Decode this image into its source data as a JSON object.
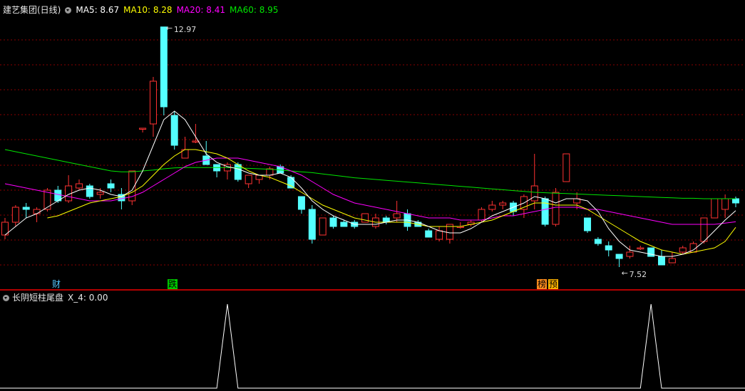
{
  "header": {
    "title": "建艺集团(日线)",
    "ma5": "MA5: 8.67",
    "ma10": "MA10: 8.28",
    "ma20": "MA20: 8.41",
    "ma60": "MA60: 8.95"
  },
  "sub_header": {
    "title": "长阴短柱尾盘",
    "value": "X_4: 0.00"
  },
  "tags": {
    "t1": "财",
    "t2": "跌",
    "t3": "榜",
    "t4": "预"
  },
  "annotations": {
    "high": "12.97",
    "low": "7.52"
  },
  "colors": {
    "up": "#ff3232",
    "down": "#54ffff",
    "ma5": "#ffffff",
    "ma10": "#ffff00",
    "ma20": "#ff00ff",
    "ma60": "#00e600",
    "grid": "#8a0000",
    "sep": "#b40000"
  },
  "chart_data": [
    {
      "type": "candlestick",
      "ylim": [
        7.1,
        13.2
      ],
      "grid": true,
      "candles": [
        [
          8.1,
          8.4,
          8.5,
          8.0
        ],
        [
          8.4,
          8.75,
          8.8,
          8.3
        ],
        [
          8.75,
          8.7,
          8.85,
          8.5
        ],
        [
          8.6,
          8.7,
          8.75,
          8.4
        ],
        [
          8.7,
          9.15,
          9.2,
          8.65
        ],
        [
          9.15,
          8.9,
          9.25,
          8.85
        ],
        [
          8.9,
          9.25,
          9.5,
          8.85
        ],
        [
          9.2,
          9.3,
          9.4,
          9.15
        ],
        [
          9.25,
          9.0,
          9.3,
          8.95
        ],
        [
          9.05,
          9.1,
          9.2,
          8.95
        ],
        [
          9.3,
          9.2,
          9.4,
          9.1
        ],
        [
          9.05,
          8.9,
          9.2,
          8.7
        ],
        [
          8.9,
          9.6,
          9.6,
          8.8
        ],
        [
          10.6,
          10.6,
          10.6,
          10.5
        ],
        [
          10.7,
          11.7,
          11.8,
          10.4
        ],
        [
          12.97,
          11.1,
          12.97,
          10.9
        ],
        [
          10.9,
          10.2,
          11.0,
          10.1
        ],
        [
          9.9,
          10.1,
          10.4,
          9.9
        ],
        [
          10.3,
          10.3,
          10.7,
          10.25
        ],
        [
          9.95,
          9.75,
          10.3,
          9.75
        ],
        [
          9.75,
          9.6,
          9.75,
          9.45
        ],
        [
          9.6,
          9.75,
          9.8,
          9.4
        ],
        [
          9.75,
          9.4,
          9.8,
          9.35
        ],
        [
          9.3,
          9.5,
          9.5,
          9.2
        ],
        [
          9.4,
          9.5,
          9.5,
          9.3
        ],
        [
          9.5,
          9.65,
          9.7,
          9.4
        ],
        [
          9.7,
          9.55,
          9.75,
          9.55
        ],
        [
          9.45,
          9.2,
          9.5,
          9.2
        ],
        [
          9.0,
          8.7,
          9.0,
          8.6
        ],
        [
          8.7,
          8.0,
          8.8,
          7.9
        ],
        [
          8.1,
          8.5,
          8.5,
          8.1
        ],
        [
          8.5,
          8.3,
          8.55,
          8.25
        ],
        [
          8.4,
          8.3,
          8.45,
          8.3
        ],
        [
          8.4,
          8.3,
          8.45,
          8.25
        ],
        [
          8.4,
          8.6,
          8.6,
          8.4
        ],
        [
          8.3,
          8.5,
          8.6,
          8.25
        ],
        [
          8.5,
          8.4,
          8.55,
          8.35
        ],
        [
          8.5,
          8.6,
          8.9,
          8.4
        ],
        [
          8.6,
          8.3,
          8.7,
          8.2
        ],
        [
          8.4,
          8.3,
          8.45,
          8.3
        ],
        [
          8.2,
          8.05,
          8.25,
          8.05
        ],
        [
          8.0,
          8.2,
          8.3,
          7.95
        ],
        [
          8.0,
          8.35,
          8.35,
          7.9
        ],
        [
          8.3,
          8.3,
          8.4,
          8.25
        ],
        [
          8.35,
          8.4,
          8.45,
          8.3
        ],
        [
          8.45,
          8.7,
          8.75,
          8.4
        ],
        [
          8.7,
          8.8,
          8.9,
          8.65
        ],
        [
          8.8,
          8.85,
          8.9,
          8.7
        ],
        [
          8.85,
          8.65,
          8.9,
          8.55
        ],
        [
          8.7,
          9.0,
          9.05,
          8.5
        ],
        [
          8.9,
          9.25,
          10.0,
          8.7
        ],
        [
          8.95,
          8.35,
          9.0,
          8.3
        ],
        [
          8.35,
          9.1,
          9.2,
          8.3
        ],
        [
          9.35,
          10.0,
          10.0,
          9.35
        ],
        [
          8.85,
          8.95,
          9.1,
          8.7
        ],
        [
          8.5,
          8.2,
          8.5,
          8.15
        ],
        [
          8.0,
          7.9,
          8.05,
          7.85
        ],
        [
          7.85,
          7.75,
          7.95,
          7.6
        ],
        [
          7.65,
          7.55,
          7.65,
          7.35
        ],
        [
          7.6,
          7.7,
          7.85,
          7.55
        ],
        [
          7.8,
          7.8,
          7.85,
          7.75
        ],
        [
          7.8,
          7.6,
          7.8,
          7.6
        ],
        [
          7.6,
          7.4,
          7.75,
          7.4
        ],
        [
          7.45,
          7.55,
          7.7,
          7.52
        ],
        [
          7.7,
          7.8,
          7.85,
          7.65
        ],
        [
          7.7,
          7.9,
          7.95,
          7.7
        ],
        [
          7.95,
          8.5,
          8.5,
          7.9
        ],
        [
          8.5,
          8.95,
          8.95,
          8.5
        ],
        [
          8.7,
          8.95,
          9.05,
          8.5
        ],
        [
          8.95,
          8.85,
          9.0,
          8.75
        ]
      ],
      "ma5": [
        8.1,
        8.3,
        8.5,
        8.6,
        8.75,
        8.9,
        9.05,
        9.15,
        9.2,
        9.15,
        9.05,
        9.0,
        9.15,
        9.6,
        10.2,
        10.8,
        11.0,
        10.8,
        10.4,
        10.0,
        9.8,
        9.7,
        9.65,
        9.55,
        9.5,
        9.5,
        9.55,
        9.45,
        9.2,
        8.9,
        8.7,
        8.55,
        8.45,
        8.35,
        8.35,
        8.35,
        8.4,
        8.45,
        8.45,
        8.4,
        8.3,
        8.2,
        8.15,
        8.15,
        8.25,
        8.4,
        8.55,
        8.65,
        8.75,
        8.85,
        9.0,
        8.95,
        8.85,
        8.95,
        8.95,
        8.9,
        8.65,
        8.25,
        7.95,
        7.75,
        7.7,
        7.65,
        7.6,
        7.6,
        7.65,
        7.75,
        7.95,
        8.2,
        8.45,
        8.67
      ],
      "ma10": [
        null,
        null,
        null,
        null,
        8.5,
        8.55,
        8.65,
        8.75,
        8.85,
        8.9,
        8.95,
        9.0,
        9.1,
        9.25,
        9.5,
        9.75,
        9.95,
        10.1,
        10.1,
        10.05,
        10.0,
        9.9,
        9.75,
        9.6,
        9.5,
        9.45,
        9.35,
        9.25,
        9.1,
        8.95,
        8.8,
        8.7,
        8.6,
        8.5,
        8.45,
        8.4,
        8.4,
        8.4,
        8.4,
        8.35,
        8.3,
        8.3,
        8.3,
        8.3,
        8.35,
        8.4,
        8.45,
        8.55,
        8.65,
        8.75,
        8.85,
        8.85,
        8.8,
        8.8,
        8.8,
        8.7,
        8.55,
        8.4,
        8.25,
        8.1,
        7.95,
        7.85,
        7.75,
        7.7,
        7.65,
        7.7,
        7.75,
        7.8,
        7.95,
        8.28
      ],
      "ma20": [
        9.3,
        9.25,
        9.2,
        9.15,
        9.1,
        9.05,
        9.0,
        8.95,
        8.9,
        8.9,
        8.9,
        8.95,
        9.0,
        9.1,
        9.25,
        9.4,
        9.55,
        9.7,
        9.8,
        9.85,
        9.9,
        9.9,
        9.9,
        9.85,
        9.8,
        9.75,
        9.7,
        9.6,
        9.5,
        9.35,
        9.2,
        9.05,
        8.95,
        8.85,
        8.8,
        8.75,
        8.7,
        8.65,
        8.6,
        8.55,
        8.5,
        8.5,
        8.5,
        8.45,
        8.45,
        8.45,
        8.5,
        8.55,
        8.55,
        8.6,
        8.65,
        8.7,
        8.75,
        8.75,
        8.75,
        8.7,
        8.7,
        8.65,
        8.6,
        8.55,
        8.5,
        8.45,
        8.4,
        8.35,
        8.35,
        8.35,
        8.35,
        8.35,
        8.38,
        8.41
      ],
      "ma60": [
        10.1,
        10.05,
        10.0,
        9.95,
        9.9,
        9.85,
        9.8,
        9.75,
        9.7,
        9.65,
        9.6,
        9.58,
        9.58,
        9.6,
        9.62,
        9.65,
        9.67,
        9.68,
        9.68,
        9.68,
        9.68,
        9.68,
        9.67,
        9.66,
        9.65,
        9.64,
        9.62,
        9.6,
        9.58,
        9.56,
        9.53,
        9.5,
        9.47,
        9.44,
        9.42,
        9.4,
        9.38,
        9.36,
        9.34,
        9.32,
        9.3,
        9.28,
        9.26,
        9.24,
        9.22,
        9.2,
        9.18,
        9.16,
        9.14,
        9.12,
        9.1,
        9.09,
        9.08,
        9.07,
        9.06,
        9.05,
        9.04,
        9.03,
        9.02,
        9.01,
        9.0,
        8.99,
        8.98,
        8.97,
        8.96,
        8.96,
        8.95,
        8.95,
        8.95,
        8.95
      ]
    },
    {
      "type": "line",
      "name": "X_4",
      "ylim": [
        0,
        1
      ],
      "values": [
        0,
        0,
        0,
        0,
        0,
        0,
        0,
        0,
        0,
        0,
        0,
        0,
        0,
        0,
        0,
        0,
        0,
        0,
        0,
        0,
        0,
        1,
        0,
        0,
        0,
        0,
        0,
        0,
        0,
        0,
        0,
        0,
        0,
        0,
        0,
        0,
        0,
        0,
        0,
        0,
        0,
        0,
        0,
        0,
        0,
        0,
        0,
        0,
        0,
        0,
        0,
        0,
        0,
        0,
        0,
        0,
        0,
        0,
        0,
        0,
        0,
        1,
        0,
        0,
        0,
        0,
        0,
        0,
        0,
        0
      ]
    }
  ]
}
